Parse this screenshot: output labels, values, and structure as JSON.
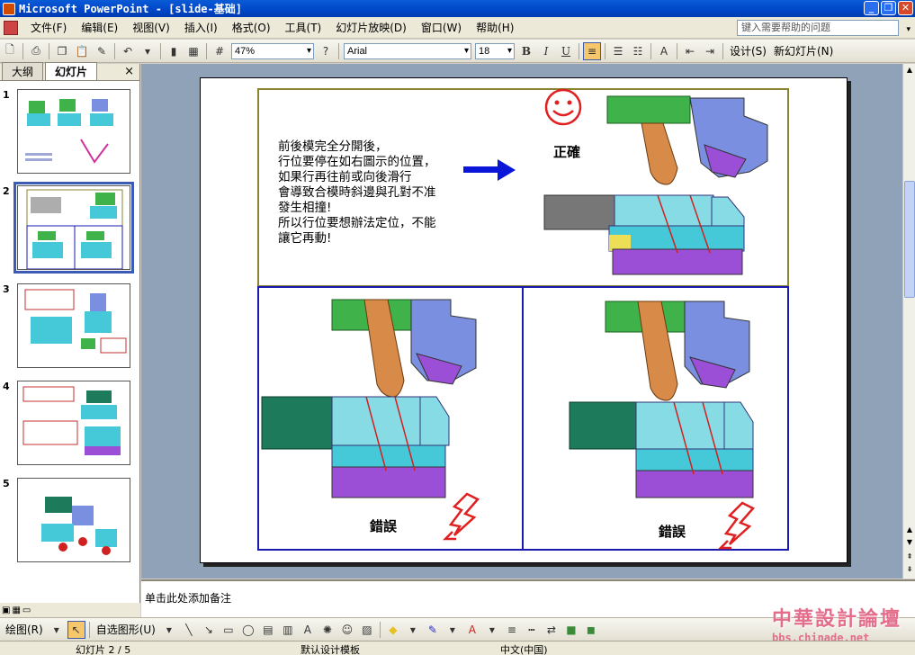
{
  "window": {
    "title": "Microsoft PowerPoint - [slide-基础]",
    "minimize": "_",
    "restore": "❐",
    "close": "✕"
  },
  "menu": {
    "items": [
      "文件(F)",
      "编辑(E)",
      "视图(V)",
      "插入(I)",
      "格式(O)",
      "工具(T)",
      "幻灯片放映(D)",
      "窗口(W)",
      "帮助(H)"
    ],
    "help_placeholder": "键入需要帮助的问题"
  },
  "toolbar": {
    "zoom": "47%",
    "font": "Arial",
    "size": "18",
    "bold": "B",
    "italic": "I",
    "underline": "U",
    "design": "设计(S)",
    "new_slide": "新幻灯片(N)"
  },
  "left_pane": {
    "tab_outline": "大纲",
    "tab_slides": "幻灯片",
    "close": "×",
    "slides": [
      {
        "num": "1"
      },
      {
        "num": "2",
        "selected": true
      },
      {
        "num": "3"
      },
      {
        "num": "4"
      },
      {
        "num": "5"
      }
    ]
  },
  "slide": {
    "description": [
      "前後模完全分開後，",
      "行位要停在如右圖示的位置，",
      "如果行再往前或向後滑行",
      "會導致合模時斜邊與孔對不准",
      "發生相撞!",
      "所以行位要想辦法定位，不能",
      "讓它再動!"
    ],
    "correct_label": "正確",
    "wrong_label_left": "錯誤",
    "wrong_label_right": "錯誤"
  },
  "notes": {
    "placeholder": "单击此处添加备注"
  },
  "draw_toolbar": {
    "draw": "绘图(R)",
    "autoshapes": "自选图形(U)"
  },
  "status": {
    "slide": "幻灯片 2 / 5",
    "template": "默认设计模板",
    "language": "中文(中国)"
  },
  "watermark": {
    "main": "中華設計論壇",
    "sub": "bbs.chinade.net"
  },
  "colors": {
    "mold_green": "#3fb24a",
    "mold_blue": "#7a8fe0",
    "mold_purple": "#9b4fd6",
    "mold_cyan": "#45c8d8",
    "mold_teal": "#1d7a5a",
    "arrow_blue": "#0a16d8",
    "smiley_red": "#e02020",
    "bolt_red": "#e02020"
  }
}
